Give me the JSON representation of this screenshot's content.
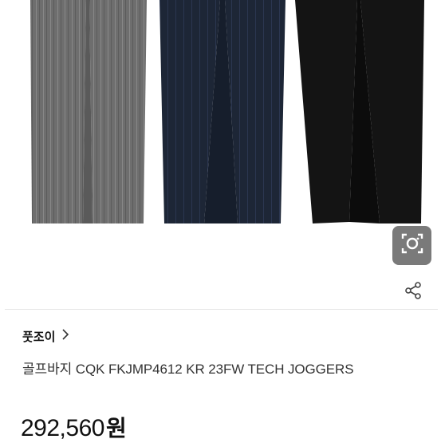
{
  "product": {
    "brand": "풋조이",
    "title": "골프바지 CQK FKJMP4612 KR 23FW TECH JOGGERS",
    "price_value": "292,560",
    "price_unit": "원"
  },
  "icons": {
    "lens": "image-search-icon",
    "share": "share-icon",
    "brand_chevron": "chevron-right-icon"
  },
  "colors": {
    "pants_gray": "#6e6e6e",
    "pants_navy": "#1d2636",
    "pants_black": "#141414",
    "lens_button_bg": "#7a7a7a"
  }
}
